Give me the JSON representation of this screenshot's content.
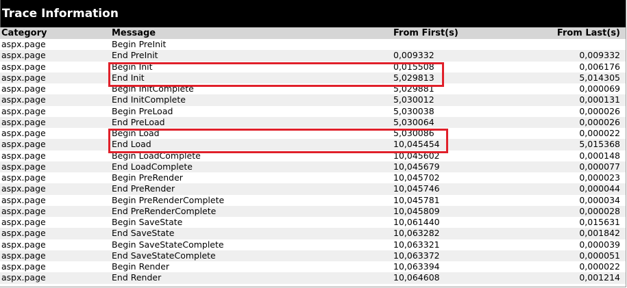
{
  "section": {
    "title": "Trace Information"
  },
  "columns": {
    "category": "Category",
    "message": "Message",
    "from_first": "From First(s)",
    "from_last": "From Last(s)"
  },
  "rows": [
    {
      "category": "aspx.page",
      "message": "Begin PreInit",
      "from_first": "",
      "from_last": ""
    },
    {
      "category": "aspx.page",
      "message": "End PreInit",
      "from_first": "0,009332",
      "from_last": "0,009332"
    },
    {
      "category": "aspx.page",
      "message": "Begin Init",
      "from_first": "0,015508",
      "from_last": "0,006176"
    },
    {
      "category": "aspx.page",
      "message": "End Init",
      "from_first": "5,029813",
      "from_last": "5,014305"
    },
    {
      "category": "aspx.page",
      "message": "Begin InitComplete",
      "from_first": "5,029881",
      "from_last": "0,000069"
    },
    {
      "category": "aspx.page",
      "message": "End InitComplete",
      "from_first": "5,030012",
      "from_last": "0,000131"
    },
    {
      "category": "aspx.page",
      "message": "Begin PreLoad",
      "from_first": "5,030038",
      "from_last": "0,000026"
    },
    {
      "category": "aspx.page",
      "message": "End PreLoad",
      "from_first": "5,030064",
      "from_last": "0,000026"
    },
    {
      "category": "aspx.page",
      "message": "Begin Load",
      "from_first": "5,030086",
      "from_last": "0,000022"
    },
    {
      "category": "aspx.page",
      "message": "End Load",
      "from_first": "10,045454",
      "from_last": "5,015368"
    },
    {
      "category": "aspx.page",
      "message": "Begin LoadComplete",
      "from_first": "10,045602",
      "from_last": "0,000148"
    },
    {
      "category": "aspx.page",
      "message": "End LoadComplete",
      "from_first": "10,045679",
      "from_last": "0,000077"
    },
    {
      "category": "aspx.page",
      "message": "Begin PreRender",
      "from_first": "10,045702",
      "from_last": "0,000023"
    },
    {
      "category": "aspx.page",
      "message": "End PreRender",
      "from_first": "10,045746",
      "from_last": "0,000044"
    },
    {
      "category": "aspx.page",
      "message": "Begin PreRenderComplete",
      "from_first": "10,045781",
      "from_last": "0,000034"
    },
    {
      "category": "aspx.page",
      "message": "End PreRenderComplete",
      "from_first": "10,045809",
      "from_last": "0,000028"
    },
    {
      "category": "aspx.page",
      "message": "Begin SaveState",
      "from_first": "10,061440",
      "from_last": "0,015631"
    },
    {
      "category": "aspx.page",
      "message": "End SaveState",
      "from_first": "10,063282",
      "from_last": "0,001842"
    },
    {
      "category": "aspx.page",
      "message": "Begin SaveStateComplete",
      "from_first": "10,063321",
      "from_last": "0,000039"
    },
    {
      "category": "aspx.page",
      "message": "End SaveStateComplete",
      "from_first": "10,063372",
      "from_last": "0,000051"
    },
    {
      "category": "aspx.page",
      "message": "Begin Render",
      "from_first": "10,063394",
      "from_last": "0,000022"
    },
    {
      "category": "aspx.page",
      "message": "End Render",
      "from_first": "10,064608",
      "from_last": "0,001214"
    }
  ],
  "highlight_color": "#e0202a"
}
